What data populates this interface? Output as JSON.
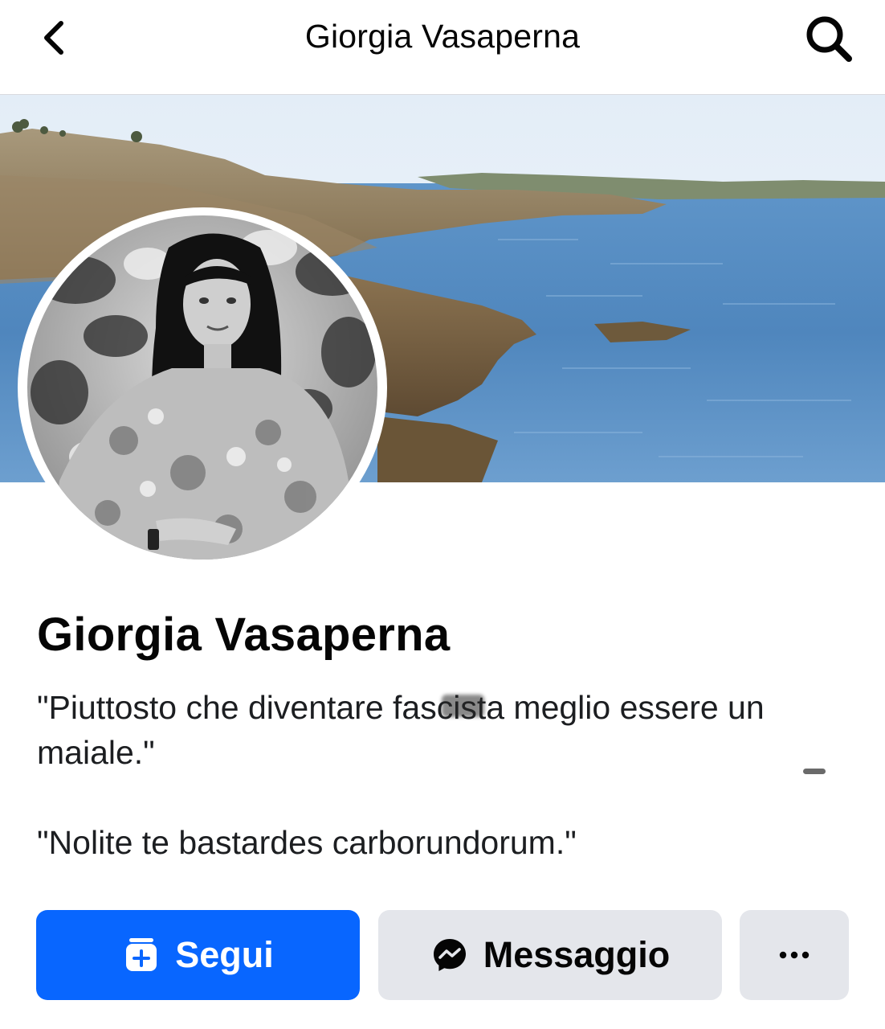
{
  "topbar": {
    "title": "Giorgia Vasaperna",
    "back_icon": "chevron-left-icon",
    "search_icon": "search-icon"
  },
  "profile": {
    "name": "Giorgia Vasaperna",
    "bio": {
      "line1_pre": "\"Piuttosto che diventare fas",
      "line1_redacted": "cist",
      "line1_post": "a meglio essere un maiale.\"",
      "line2": "\"Nolite te bastardes carborundorum.\""
    }
  },
  "actions": {
    "follow_label": "Segui",
    "follow_icon": "follow-plus-icon",
    "message_label": "Messaggio",
    "message_icon": "messenger-icon",
    "more_icon": "more-dots-icon"
  },
  "colors": {
    "primary": "#0866ff",
    "secondary_button": "#e4e6eb",
    "text": "#050505"
  }
}
